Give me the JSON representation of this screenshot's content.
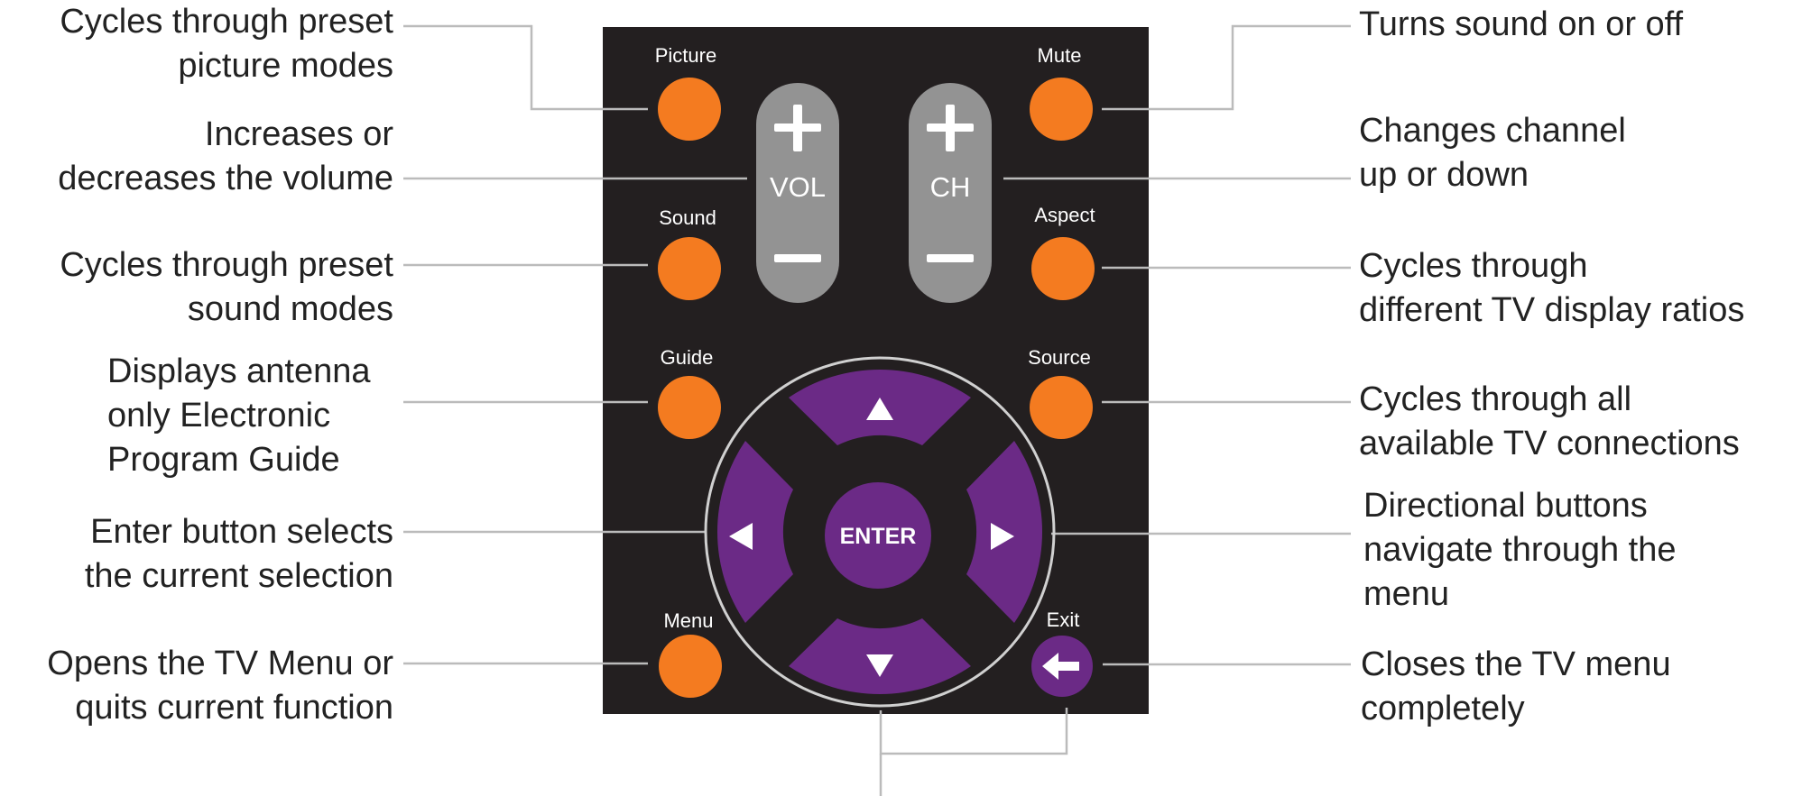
{
  "colors": {
    "remote_body": "#231f20",
    "orange_button": "#f47b20",
    "purple_button": "#6b2a86",
    "rocker": "#939393",
    "leader_line": "#bbbbbb",
    "text": "#222222"
  },
  "remote": {
    "picture_label": "Picture",
    "mute_label": "Mute",
    "sound_label": "Sound",
    "aspect_label": "Aspect",
    "guide_label": "Guide",
    "source_label": "Source",
    "menu_label": "Menu",
    "exit_label": "Exit",
    "vol_label": "VOL",
    "ch_label": "CH",
    "enter_label": "ENTER"
  },
  "callouts": {
    "picture": "Cycles through preset\npicture modes",
    "volume": "Increases or\ndecreases the volume",
    "sound": "Cycles through preset\nsound modes",
    "guide": "Displays antenna\nonly Electronic\nProgram Guide",
    "enter": "Enter button selects\nthe current selection",
    "menu": "Opens the TV Menu or\nquits current function",
    "mute": "Turns sound on or off",
    "channel": "Changes channel\nup or down",
    "aspect": "Cycles through\ndifferent TV display ratios",
    "source": "Cycles through all\navailable TV connections",
    "directional": "Directional buttons\nnavigate through the\nmenu",
    "exit": "Closes the TV menu\ncompletely"
  }
}
